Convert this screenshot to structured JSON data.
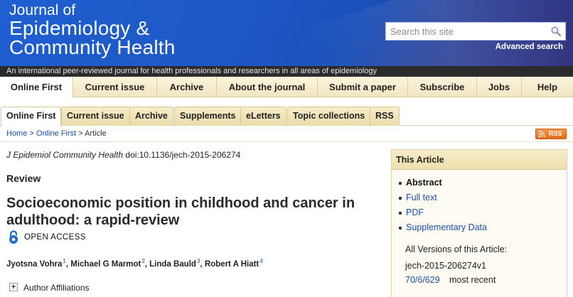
{
  "header": {
    "logo": {
      "line1": "Journal of",
      "line2": "Epidemiology &",
      "line3": "Community Health"
    },
    "search": {
      "placeholder": "Search this site",
      "icon": "search-icon"
    },
    "advanced_search_label": "Advanced search",
    "tagline": "An international peer-reviewed journal for health professionals and researchers in all areas of epidemiology",
    "colors": {
      "banner": "#1f5fd1",
      "tagline_bg": "#2b2b2b"
    }
  },
  "main_nav": {
    "active": "Online First",
    "items": [
      "Online First",
      "Current issue",
      "Archive",
      "About the journal",
      "Submit a paper",
      "Subscribe",
      "Jobs",
      "Help"
    ]
  },
  "sub_nav": {
    "active": "Online First",
    "items": [
      "Online First",
      "Current issue",
      "Archive",
      "Supplements",
      "eLetters",
      "Topic collections",
      "RSS"
    ]
  },
  "breadcrumb": {
    "home": "Home",
    "sep1": " > ",
    "online_first": "Online First",
    "sep2": " > ",
    "current": "Article"
  },
  "rss_badge": {
    "label": "RSS",
    "color": "#e56a17"
  },
  "article": {
    "journal": "J Epidemiol Community Health",
    "doi": " doi:10.1136/jech-2015-206274",
    "type": "Review",
    "title": "Socioeconomic position in childhood and cancer in adulthood: a rapid-review",
    "open_access_label": "OPEN ACCESS",
    "authors": [
      {
        "name": "Jyotsna Vohra",
        "aff": "1"
      },
      {
        "name": "Michael G Marmot",
        "aff": "2"
      },
      {
        "name": "Linda Bauld",
        "aff": "3"
      },
      {
        "name": "Robert A Hiatt",
        "aff": "4"
      }
    ],
    "author_sep": ", ",
    "affiliations_toggle": "+",
    "affiliations_label": "Author Affiliations"
  },
  "this_article": {
    "heading": "This Article",
    "links": [
      {
        "label": "Abstract",
        "current": true
      },
      {
        "label": "Full text",
        "current": false
      },
      {
        "label": "PDF",
        "current": false
      },
      {
        "label": "Supplementary Data",
        "current": false
      }
    ],
    "versions_label": "All Versions of this Article:",
    "version_id": "jech-2015-206274v1",
    "version_link": "70/6/629",
    "version_note": "most recent"
  }
}
